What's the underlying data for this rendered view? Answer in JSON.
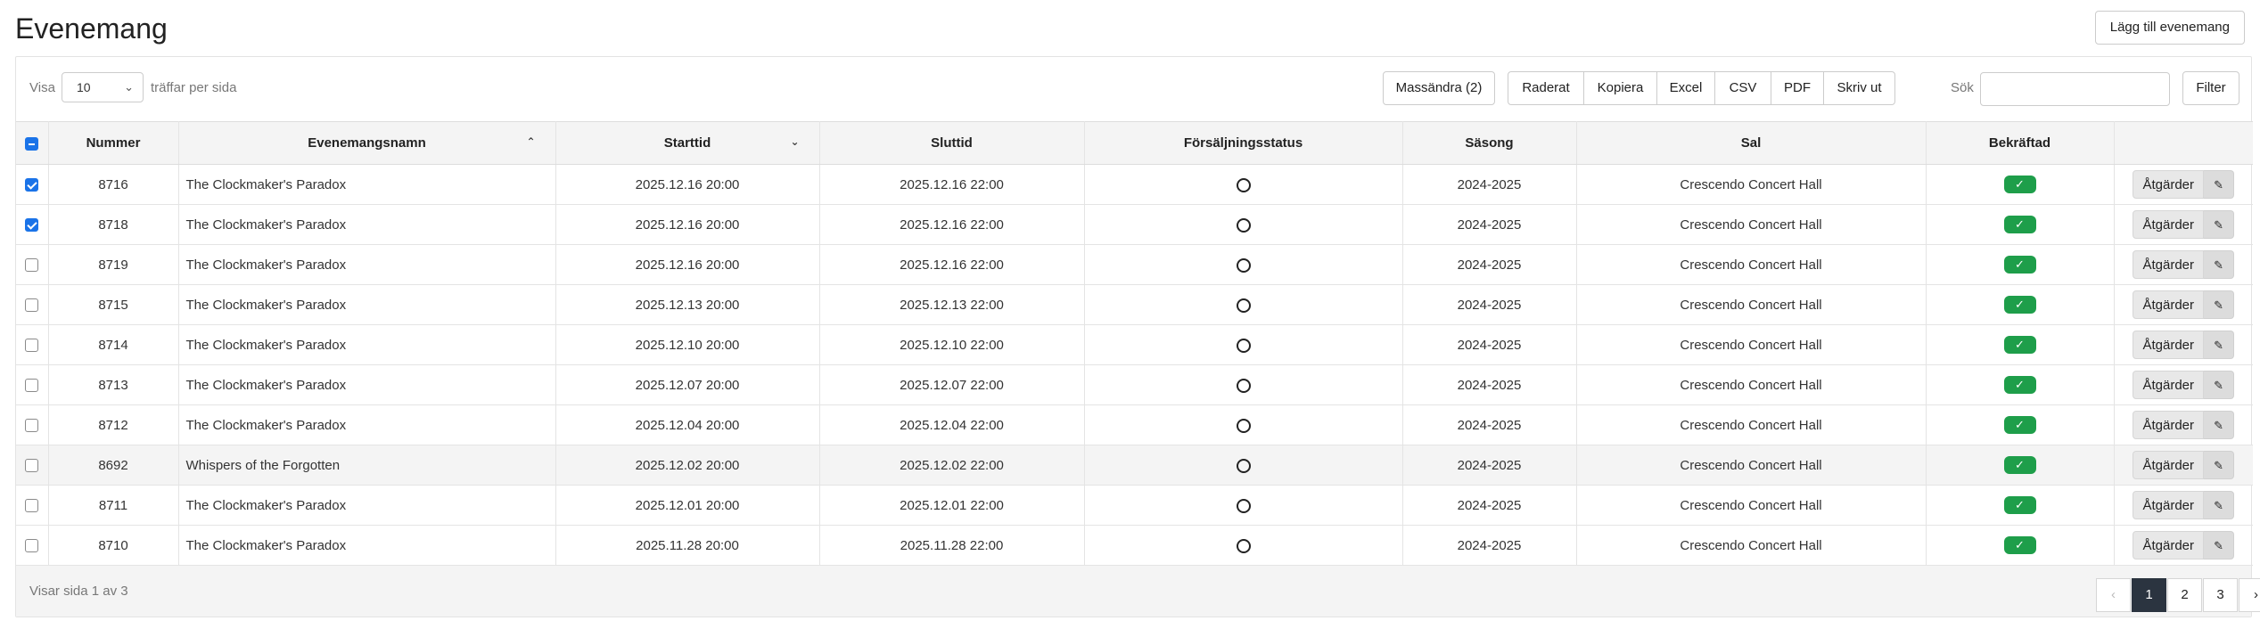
{
  "page": {
    "title": "Evenemang",
    "add_button": "Lägg till evenemang"
  },
  "toolbar": {
    "show_prefix": "Visa",
    "page_length": "10",
    "show_suffix": "träffar per sida",
    "mass_edit": "Massändra (2)",
    "export_buttons": [
      "Raderat",
      "Kopiera",
      "Excel",
      "CSV",
      "PDF",
      "Skriv ut"
    ],
    "search_label": "Sök",
    "search_value": "",
    "filter_button": "Filter"
  },
  "table": {
    "columns": [
      "Nummer",
      "Evenemangsnamn",
      "Starttid",
      "Sluttid",
      "Försäljningsstatus",
      "Säsong",
      "Sal",
      "Bekräftad"
    ],
    "sorted_asc_column": "Evenemangsnamn",
    "sorted_desc_column": "Starttid",
    "header_checkbox_state": "mixed",
    "action_label": "Åtgärder",
    "rows": [
      {
        "checked": true,
        "number": "8716",
        "name": "The Clockmaker's Paradox",
        "start": "2025.12.16 20:00",
        "end": "2025.12.16 22:00",
        "season": "2024-2025",
        "hall": "Crescendo Concert Hall",
        "confirmed": true
      },
      {
        "checked": true,
        "number": "8718",
        "name": "The Clockmaker's Paradox",
        "start": "2025.12.16 20:00",
        "end": "2025.12.16 22:00",
        "season": "2024-2025",
        "hall": "Crescendo Concert Hall",
        "confirmed": true
      },
      {
        "checked": false,
        "number": "8719",
        "name": "The Clockmaker's Paradox",
        "start": "2025.12.16 20:00",
        "end": "2025.12.16 22:00",
        "season": "2024-2025",
        "hall": "Crescendo Concert Hall",
        "confirmed": true
      },
      {
        "checked": false,
        "number": "8715",
        "name": "The Clockmaker's Paradox",
        "start": "2025.12.13 20:00",
        "end": "2025.12.13 22:00",
        "season": "2024-2025",
        "hall": "Crescendo Concert Hall",
        "confirmed": true
      },
      {
        "checked": false,
        "number": "8714",
        "name": "The Clockmaker's Paradox",
        "start": "2025.12.10 20:00",
        "end": "2025.12.10 22:00",
        "season": "2024-2025",
        "hall": "Crescendo Concert Hall",
        "confirmed": true
      },
      {
        "checked": false,
        "number": "8713",
        "name": "The Clockmaker's Paradox",
        "start": "2025.12.07 20:00",
        "end": "2025.12.07 22:00",
        "season": "2024-2025",
        "hall": "Crescendo Concert Hall",
        "confirmed": true
      },
      {
        "checked": false,
        "number": "8712",
        "name": "The Clockmaker's Paradox",
        "start": "2025.12.04 20:00",
        "end": "2025.12.04 22:00",
        "season": "2024-2025",
        "hall": "Crescendo Concert Hall",
        "confirmed": true
      },
      {
        "checked": false,
        "number": "8692",
        "name": "Whispers of the Forgotten",
        "start": "2025.12.02 20:00",
        "end": "2025.12.02 22:00",
        "season": "2024-2025",
        "hall": "Crescendo Concert Hall",
        "confirmed": true,
        "hovered": true
      },
      {
        "checked": false,
        "number": "8711",
        "name": "The Clockmaker's Paradox",
        "start": "2025.12.01 20:00",
        "end": "2025.12.01 22:00",
        "season": "2024-2025",
        "hall": "Crescendo Concert Hall",
        "confirmed": true
      },
      {
        "checked": false,
        "number": "8710",
        "name": "The Clockmaker's Paradox",
        "start": "2025.11.28 20:00",
        "end": "2025.11.28 22:00",
        "season": "2024-2025",
        "hall": "Crescendo Concert Hall",
        "confirmed": true
      }
    ]
  },
  "footer": {
    "info": "Visar sida 1 av 3",
    "pages": [
      "1",
      "2",
      "3"
    ],
    "current_page": "1"
  },
  "icons": {
    "select_chevron": "chevron-down-icon",
    "sort_asc": "sort-up-icon",
    "sort_desc": "sort-down-icon",
    "sales_status": "circle-outline-icon",
    "confirmed": "check-icon",
    "edit": "pencil-icon",
    "prev": "chevron-left-icon",
    "next": "chevron-right-icon"
  },
  "colors": {
    "confirmed_badge": "#1e9e4a",
    "checkbox_checked": "#1a73e8",
    "active_page": "#2b3440"
  }
}
